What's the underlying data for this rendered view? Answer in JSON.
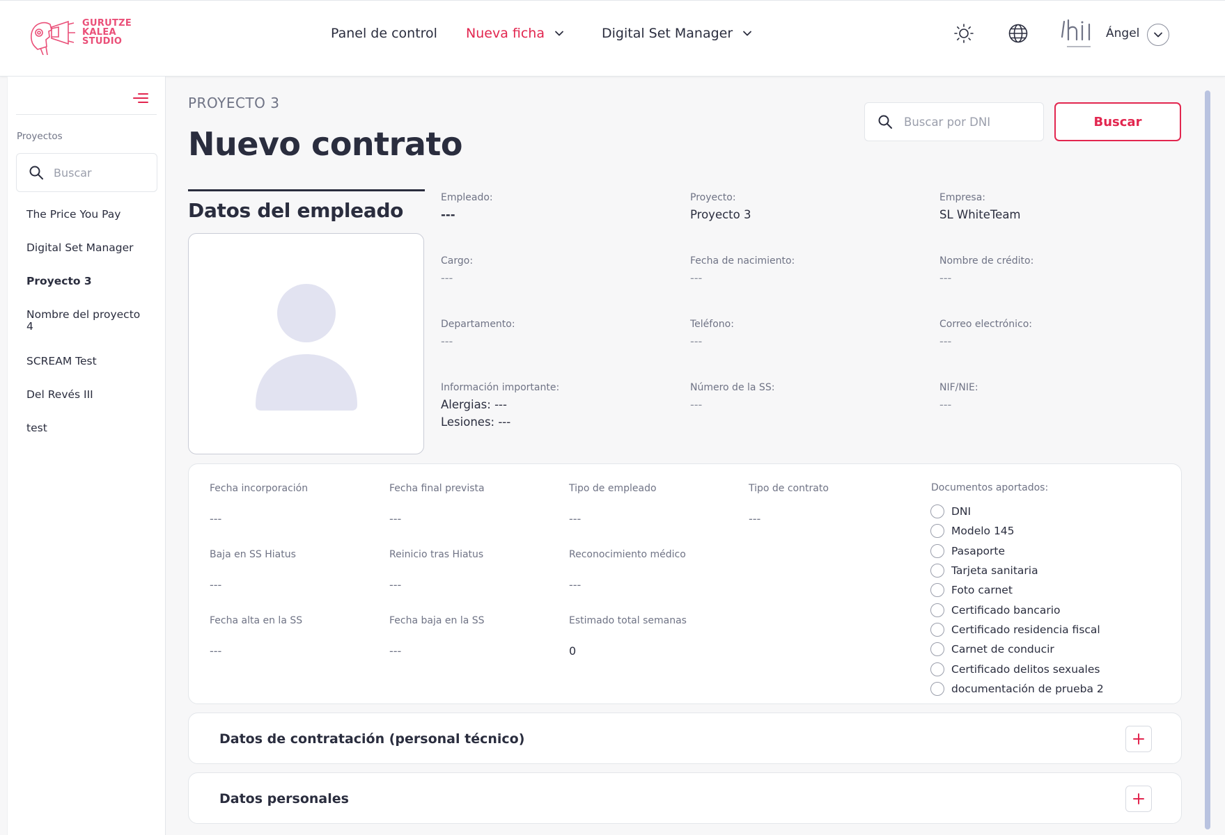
{
  "brand": {
    "logo_lines": [
      "GURUTZE",
      "KALEA",
      "STUDIO"
    ],
    "accent": "#e2264f",
    "logo_color": "#ea4f78"
  },
  "nav": {
    "items": [
      {
        "label": "Panel de control",
        "dropdown": false,
        "active": false
      },
      {
        "label": "Nueva ficha",
        "dropdown": true,
        "active": true
      },
      {
        "label": "Digital Set Manager",
        "dropdown": true,
        "active": false
      }
    ],
    "user_name": "Ángel"
  },
  "sidebar": {
    "section_label": "Proyectos",
    "search_placeholder": "Buscar",
    "projects": [
      {
        "label": "The Price You Pay",
        "selected": false
      },
      {
        "label": "Digital Set Manager",
        "selected": false
      },
      {
        "label": "Proyecto 3",
        "selected": true
      },
      {
        "label": "Nombre del proyecto 4",
        "selected": false
      },
      {
        "label": "SCREAM Test",
        "selected": false
      },
      {
        "label": "Del Revés III",
        "selected": false
      },
      {
        "label": "test",
        "selected": false
      }
    ]
  },
  "header": {
    "project": "PROYECTO 3",
    "title": "Nuevo contrato",
    "dni_placeholder": "Buscar por DNI",
    "search_button": "Buscar"
  },
  "employee": {
    "section_title": "Datos del empleado",
    "fields": {
      "empleado": {
        "label": "Empleado:",
        "value": "---"
      },
      "proyecto": {
        "label": "Proyecto:",
        "value": "Proyecto 3"
      },
      "empresa": {
        "label": "Empresa:",
        "value": "SL WhiteTeam"
      },
      "cargo": {
        "label": "Cargo:",
        "value": "---"
      },
      "nacimiento": {
        "label": "Fecha de nacimiento:",
        "value": "---"
      },
      "credito": {
        "label": "Nombre de crédito:",
        "value": "---"
      },
      "departamento": {
        "label": "Departamento:",
        "value": "---"
      },
      "telefono": {
        "label": "Teléfono:",
        "value": "---"
      },
      "correo": {
        "label": "Correo electrónico:",
        "value": "---"
      },
      "info": {
        "label": "Información importante:",
        "alergias": "Alergias: ---",
        "lesiones": "Lesiones: ---"
      },
      "ss": {
        "label": "Número de la SS:",
        "value": "---"
      },
      "nif": {
        "label": "NIF/NIE:",
        "value": "---"
      }
    }
  },
  "contract": {
    "fields": {
      "incorporacion": {
        "label": "Fecha incorporación",
        "value": "---"
      },
      "final": {
        "label": "Fecha final prevista",
        "value": "---"
      },
      "tipo_empleado": {
        "label": "Tipo de empleado",
        "value": "---"
      },
      "tipo_contrato": {
        "label": "Tipo de contrato",
        "value": "---"
      },
      "baja_hiatus": {
        "label": "Baja en SS Hiatus",
        "value": "---"
      },
      "reinicio": {
        "label": "Reinicio tras Hiatus",
        "value": "---"
      },
      "medico": {
        "label": "Reconocimiento médico",
        "value": "---"
      },
      "alta_ss": {
        "label": "Fecha alta en la SS",
        "value": "---"
      },
      "baja_ss": {
        "label": "Fecha baja en la SS",
        "value": "---"
      },
      "semanas": {
        "label": "Estimado total semanas",
        "value": "0"
      }
    },
    "docs_label": "Documentos aportados:",
    "docs": [
      "DNI",
      "Modelo 145",
      "Pasaporte",
      "Tarjeta sanitaria",
      "Foto carnet",
      "Certificado bancario",
      "Certificado residencia fiscal",
      "Carnet de conducir",
      "Certificado delitos sexuales",
      "documentación de prueba 2"
    ]
  },
  "accordions": [
    {
      "title": "Datos de contratación (personal técnico)"
    },
    {
      "title": "Datos personales"
    }
  ]
}
